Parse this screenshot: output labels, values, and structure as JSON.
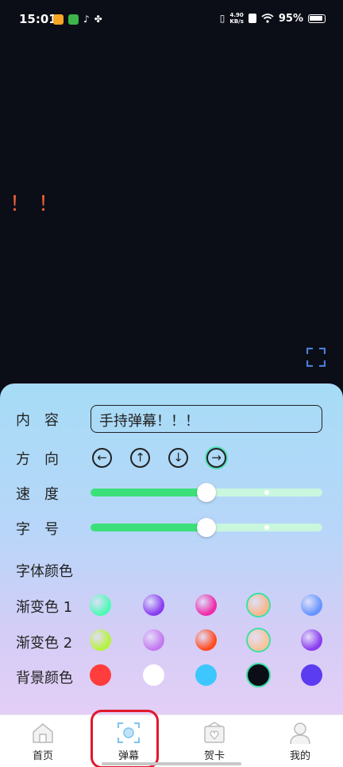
{
  "status_bar": {
    "time": "15:01",
    "net_speed_top": "4.90",
    "net_speed_bottom": "KB/s",
    "battery": "95%"
  },
  "preview": {
    "danmaku_text": "！！",
    "fullscreen_icon": "fullscreen-icon"
  },
  "settings": {
    "content": {
      "label": "内　容",
      "value": "手持弹幕！！！"
    },
    "direction": {
      "label": "方　向",
      "options": [
        "left",
        "up",
        "down",
        "right"
      ],
      "selected": "right"
    },
    "speed": {
      "label": "速　度",
      "value_percent": 50,
      "buffer_percent": 76
    },
    "font_size": {
      "label": "字　号",
      "value_percent": 50,
      "buffer_percent": 76
    },
    "font_color": {
      "label": "字体颜色"
    },
    "gradient1": {
      "label": "渐变色 1",
      "colors": [
        "#4dfab4",
        "#8a3cf0",
        "#ee2aa8",
        "#f7b88a",
        "#6694ff"
      ],
      "selected_index": 3
    },
    "gradient2": {
      "label": "渐变色 2",
      "colors": [
        "#b6f23c",
        "#c479f0",
        "#ff4a1e",
        "#f7c49a",
        "#8a3cf0"
      ],
      "selected_index": 3
    },
    "background": {
      "label": "背景颜色",
      "colors": [
        "#ff3d3d",
        "#ffffff",
        "#3cc8ff",
        "#0b0d17",
        "#5b3cf0"
      ],
      "selected_index": 3
    }
  },
  "tabs": [
    {
      "label": "首页",
      "icon": "home-icon"
    },
    {
      "label": "弹幕",
      "icon": "danmaku-scan-icon",
      "active": true
    },
    {
      "label": "贺卡",
      "icon": "greeting-card-icon"
    },
    {
      "label": "我的",
      "icon": "profile-icon"
    }
  ]
}
